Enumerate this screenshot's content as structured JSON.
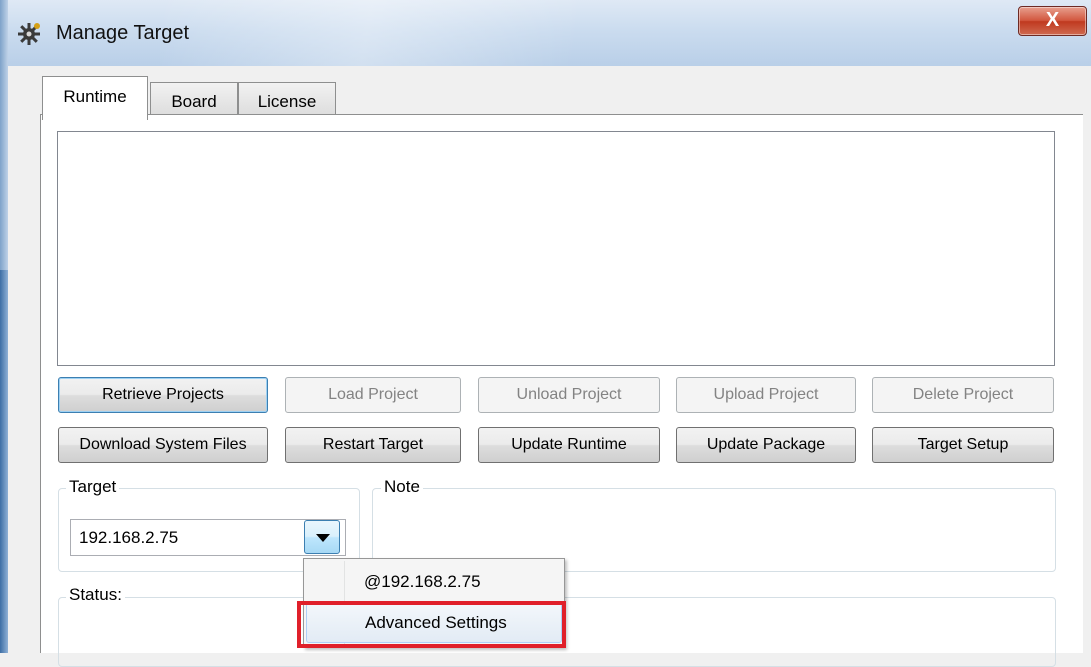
{
  "window": {
    "title": "Manage Target",
    "close_label": "X",
    "app_icon": "gear-icon"
  },
  "tabs": [
    {
      "label": "Runtime",
      "active": true
    },
    {
      "label": "Board",
      "active": false
    },
    {
      "label": "License",
      "active": false
    }
  ],
  "buttons": {
    "row1": [
      {
        "label": "Retrieve Projects",
        "enabled": true
      },
      {
        "label": "Load Project",
        "enabled": false
      },
      {
        "label": "Unload Project",
        "enabled": false
      },
      {
        "label": "Upload Project",
        "enabled": false
      },
      {
        "label": "Delete Project",
        "enabled": false
      }
    ],
    "row2": [
      {
        "label": "Download System Files",
        "enabled": true
      },
      {
        "label": "Restart Target",
        "enabled": true
      },
      {
        "label": "Update Runtime",
        "enabled": true
      },
      {
        "label": "Update Package",
        "enabled": true
      },
      {
        "label": "Target Setup",
        "enabled": true
      }
    ]
  },
  "target": {
    "label": "Target",
    "value": "192.168.2.75"
  },
  "note": {
    "label": "Note"
  },
  "status": {
    "label": "Status:"
  },
  "dropdown": {
    "items": [
      {
        "label": "@192.168.2.75"
      },
      {
        "label": "Advanced Settings",
        "highlighted": true
      }
    ]
  },
  "colors": {
    "highlight": "#e0202a",
    "accent": "#3c7fb1"
  }
}
